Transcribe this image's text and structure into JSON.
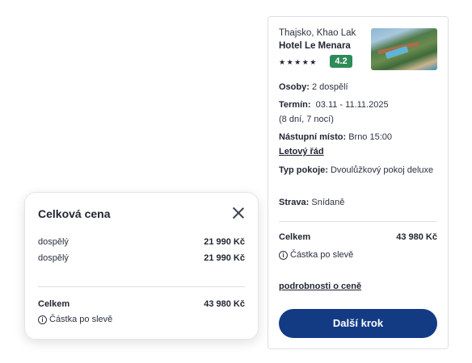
{
  "hotel": {
    "location": "Thajsko, Khao Lak",
    "name": "Hotel Le Menara",
    "stars": "★★★★★",
    "rating": "4.2"
  },
  "summary": {
    "persons_label": "Osoby:",
    "persons_value": "2 dospělí",
    "term_label": "Termín:",
    "term_value": "03.11 - 11.11.2025",
    "term_duration": "(8 dní, 7 nocí)",
    "departure_label": "Nástupní místo:",
    "departure_value": "Brno 15:00",
    "flight_schedule_link": "Letový řád",
    "room_label": "Typ pokoje:",
    "room_value": "Dvoulůžkový pokoj deluxe",
    "board_label": "Strava:",
    "board_value": "Snídaně",
    "total_label": "Celkem",
    "total_value": "43 980 Kč",
    "discount_note": "Částka po slevě",
    "price_details_link": "podrobnosti o ceně",
    "next_button": "Další krok"
  },
  "popup": {
    "title": "Celková cena",
    "rows": [
      {
        "label": "dospělý",
        "amount": "21 990 Kč"
      },
      {
        "label": "dospělý",
        "amount": "21 990 Kč"
      }
    ],
    "total_label": "Celkem",
    "total_value": "43 980 Kč",
    "discount_note": "Částka po slevě"
  },
  "colors": {
    "primary_button": "#123b84",
    "rating_badge": "#2e8b57"
  },
  "icons": {
    "info": "info-icon",
    "close": "close-icon",
    "star": "star-icon"
  }
}
